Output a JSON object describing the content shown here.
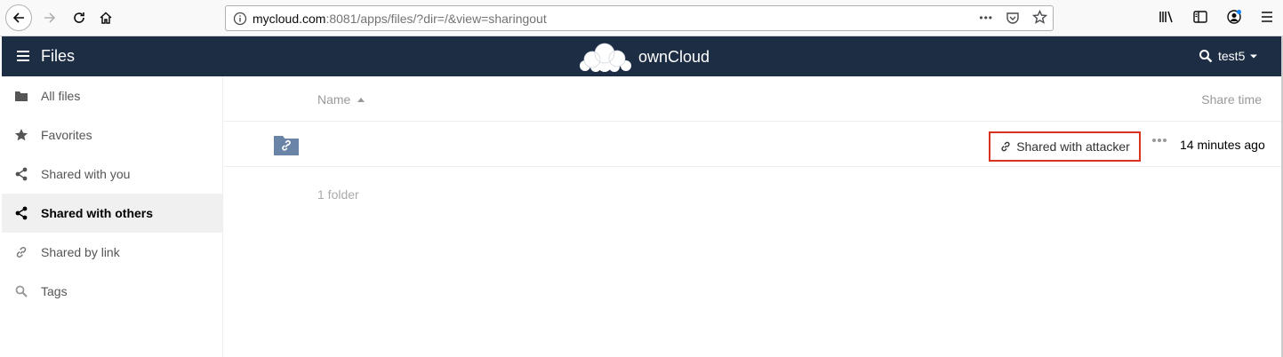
{
  "browser": {
    "url_host": "mycloud.com",
    "url_rest": ":8081/apps/files/?dir=/&view=sharingout",
    "page_actions_label": "•••"
  },
  "header": {
    "app_title": "Files",
    "logo_text": "ownCloud",
    "username": "test5",
    "bg_color": "#1d2d44"
  },
  "sidebar": {
    "items": [
      {
        "label": "All files",
        "icon": "folder-icon"
      },
      {
        "label": "Favorites",
        "icon": "star-icon"
      },
      {
        "label": "Shared with you",
        "icon": "share-icon"
      },
      {
        "label": "Shared with others",
        "icon": "share-icon",
        "active": true
      },
      {
        "label": "Shared by link",
        "icon": "link-icon"
      },
      {
        "label": "Tags",
        "icon": "tag-search-icon"
      }
    ]
  },
  "table": {
    "col_name": "Name",
    "col_time": "Share time",
    "rows": [
      {
        "name": "",
        "share_label": "Shared with attacker",
        "share_time": "14 minutes ago",
        "icon": "shared-folder-icon"
      }
    ],
    "summary": "1 folder"
  },
  "colors": {
    "highlight": "#d9331f",
    "folder": "#6a84a8"
  }
}
